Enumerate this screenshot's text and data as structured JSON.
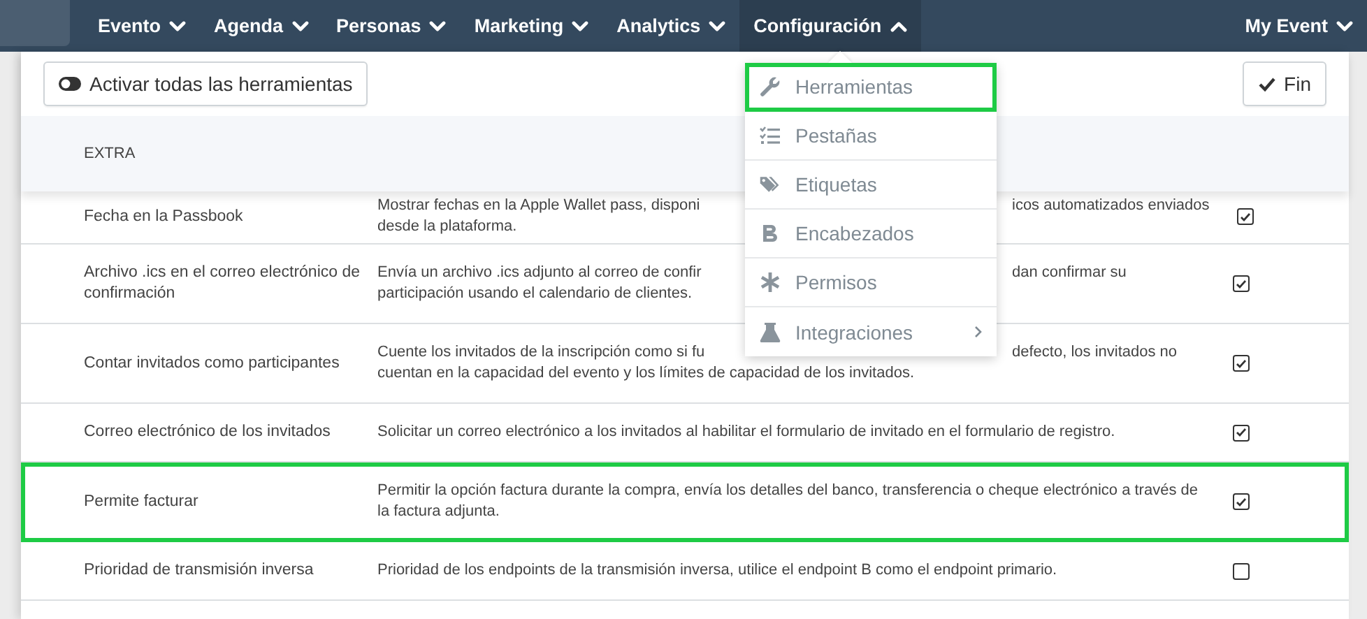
{
  "nav": {
    "items": [
      {
        "label": "Evento",
        "expanded": false
      },
      {
        "label": "Agenda",
        "expanded": false
      },
      {
        "label": "Personas",
        "expanded": false
      },
      {
        "label": "Marketing",
        "expanded": false
      },
      {
        "label": "Analytics",
        "expanded": false
      },
      {
        "label": "Configuración",
        "expanded": true
      }
    ],
    "account": {
      "label": "My Event",
      "expanded": false
    }
  },
  "toolbar": {
    "toggle_all_button": "Activar todas las herramientas",
    "done_button": "Fin"
  },
  "section_header": "EXTRA",
  "rows": [
    {
      "name": "Fecha en la Passbook",
      "lines": [
        [
          "Mostrar fechas en la Apple Wallet pass, disponi",
          "icos automatizados enviados"
        ],
        [
          "desde la plataforma."
        ]
      ],
      "checked": true,
      "highlighted": false
    },
    {
      "name": "Archivo .ics en el correo electrónico de confirmación",
      "lines": [
        [
          "Envía un archivo .ics adjunto al correo de confir",
          "dan confirmar su"
        ],
        [
          "participación usando el calendario de clientes."
        ]
      ],
      "checked": true,
      "highlighted": false
    },
    {
      "name": "Contar invitados como participantes",
      "lines": [
        [
          "Cuente los invitados de la inscripción como si fu",
          "defecto, los invitados no"
        ],
        [
          "cuentan en la capacidad del evento y los límites de capacidad de los invitados."
        ]
      ],
      "checked": true,
      "highlighted": false
    },
    {
      "name": "Correo electrónico de los invitados",
      "lines": [
        [
          "Solicitar un correo electrónico a los invitados al habilitar el formulario de invitado en el formulario de registro."
        ]
      ],
      "checked": true,
      "highlighted": false
    },
    {
      "name": "Permite facturar",
      "lines": [
        [
          "Permitir la opción factura durante la compra, envía los detalles del banco, transferencia o cheque electrónico a través de la factura adjunta."
        ]
      ],
      "checked": true,
      "highlighted": true
    },
    {
      "name": "Prioridad de transmisión inversa",
      "lines": [
        [
          "Prioridad de los endpoints de la transmisión inversa, utilice el endpoint B como el endpoint primario."
        ]
      ],
      "checked": false,
      "highlighted": false
    }
  ],
  "menu": {
    "items": [
      {
        "label": "Herramientas",
        "kind": "wrench",
        "highlighted": true,
        "submenu": false
      },
      {
        "label": "Pestañas",
        "kind": "list",
        "highlighted": false,
        "submenu": false
      },
      {
        "label": "Etiquetas",
        "kind": "tags",
        "highlighted": false,
        "submenu": false
      },
      {
        "label": "Encabezados",
        "kind": "bold",
        "highlighted": false,
        "submenu": false
      },
      {
        "label": "Permisos",
        "kind": "asterisk",
        "highlighted": false,
        "submenu": false
      },
      {
        "label": "Integraciones",
        "kind": "flask",
        "highlighted": false,
        "submenu": true
      }
    ]
  }
}
